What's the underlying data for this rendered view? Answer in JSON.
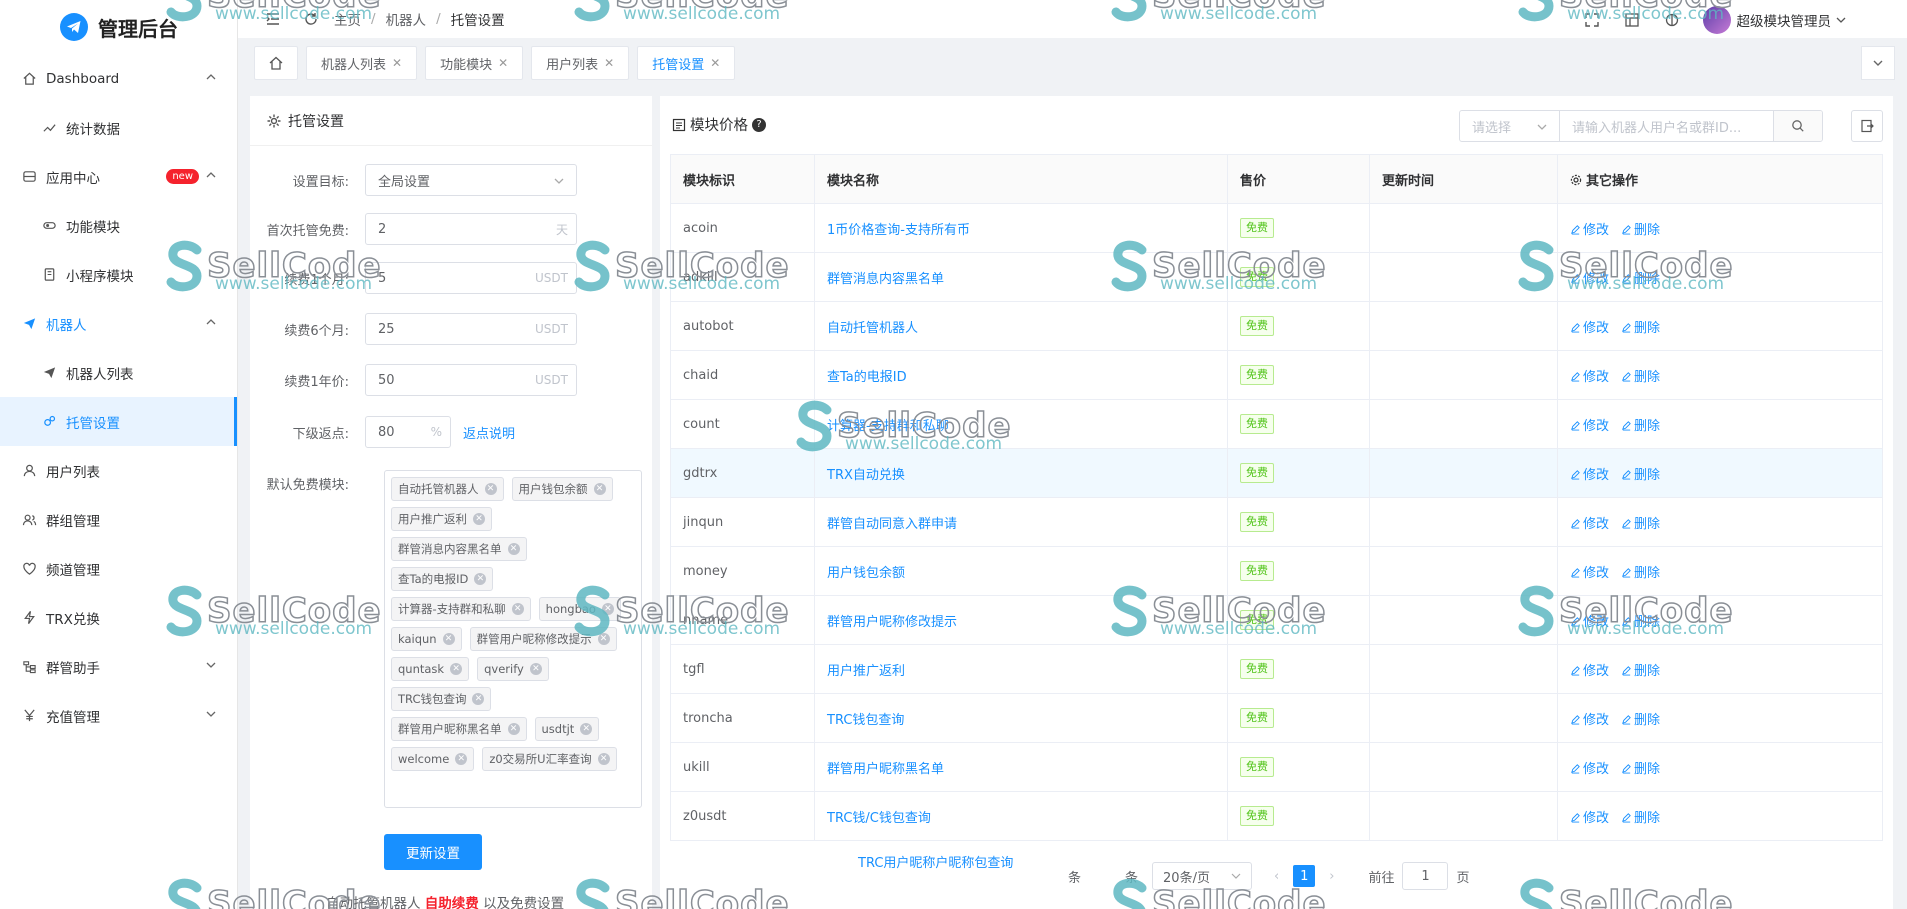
{
  "app": {
    "logo_title": "管理后台"
  },
  "sidebar": {
    "items": [
      {
        "label": "Dashboard",
        "icon": "home-icon",
        "level": 0,
        "expanded": true
      },
      {
        "label": "统计数据",
        "icon": "chart-trend-icon",
        "level": 1
      },
      {
        "label": "应用中心",
        "icon": "app-icon",
        "level": 0,
        "badge": "new",
        "expanded": true
      },
      {
        "label": "功能模块",
        "icon": "toggle-icon",
        "level": 1
      },
      {
        "label": "小程序模块",
        "icon": "mini-program-icon",
        "level": 1
      },
      {
        "label": "机器人",
        "icon": "send-icon",
        "level": 0,
        "expanded": true,
        "active": true
      },
      {
        "label": "机器人列表",
        "icon": "send-icon",
        "level": 1
      },
      {
        "label": "托管设置",
        "icon": "gears-icon",
        "level": 1,
        "selected": true
      },
      {
        "label": "用户列表",
        "icon": "user-icon",
        "level": 0
      },
      {
        "label": "群组管理",
        "icon": "group-icon",
        "level": 0
      },
      {
        "label": "频道管理",
        "icon": "heart-icon",
        "level": 0
      },
      {
        "label": "TRX兑换",
        "icon": "bolt-icon",
        "level": 0
      },
      {
        "label": "群管助手",
        "icon": "tree-icon",
        "level": 0,
        "collapsed": true
      },
      {
        "label": "充值管理",
        "icon": "yen-icon",
        "level": 0,
        "collapsed": true
      }
    ]
  },
  "header": {
    "breadcrumb": [
      "主页",
      "机器人",
      "托管设置"
    ],
    "username": "超级模块管理员"
  },
  "tabs": [
    {
      "label": "机器人列表"
    },
    {
      "label": "功能模块"
    },
    {
      "label": "用户列表"
    },
    {
      "label": "托管设置",
      "active": true
    }
  ],
  "settings": {
    "title": "托管设置",
    "target_label": "设置目标:",
    "target_value": "全局设置",
    "first_free_label": "首次托管免费:",
    "first_free_value": "2",
    "first_free_unit": "天",
    "renew1m_label": "续费1个月:",
    "renew1m_value": "5",
    "renew6m_label": "续费6个月:",
    "renew6m_value": "25",
    "renew1y_label": "续费1年价:",
    "renew1y_value": "50",
    "currency": "USDT",
    "rebate_label": "下级返点:",
    "rebate_value": "80",
    "rebate_unit": "%",
    "rebate_link": "返点说明",
    "free_modules_label": "默认免费模块:",
    "free_modules": [
      "自动托管机器人",
      "用户钱包余额",
      "用户推广返利",
      "群管消息内容黑名单",
      "查Ta的电报ID",
      "计算器-支持群和私聊",
      "hongbao",
      "kaiqun",
      "群管用户昵称修改提示",
      "quntask",
      "qverify",
      "TRC钱包查询",
      "群管用户昵称黑名单",
      "usdtjt",
      "welcome",
      "z0交易所U汇率查询"
    ],
    "update_button": "更新设置",
    "foot_prefix": "自动托管机器人",
    "foot_emph": "自助续费",
    "foot_suffix": "以及免费设置"
  },
  "module_price": {
    "title": "模块价格",
    "help": "?",
    "select_placeholder": "请选择",
    "search_placeholder": "请输入机器人用户名或群ID...",
    "columns": [
      "模块标识",
      "模块名称",
      "售价",
      "更新时间",
      "其它操作"
    ],
    "edit_label": "修改",
    "delete_label": "删除",
    "rows": [
      {
        "id": "acoin",
        "name": "1币价格查询-支持所有币",
        "price": "免费",
        "time": ""
      },
      {
        "id": "adkill",
        "name": "群管消息内容黑名单",
        "price": "免费",
        "time": ""
      },
      {
        "id": "autobot",
        "name": "自动托管机器人",
        "price": "免费",
        "time": ""
      },
      {
        "id": "chaid",
        "name": "查Ta的电报ID",
        "price": "免费",
        "time": ""
      },
      {
        "id": "count",
        "name": "计算器-支持群和私聊",
        "price": "免费",
        "time": ""
      },
      {
        "id": "gdtrx",
        "name": "TRX自动兑换",
        "price": "免费",
        "time": "",
        "highlight": true
      },
      {
        "id": "jinqun",
        "name": "群管自动同意入群申请",
        "price": "免费",
        "time": ""
      },
      {
        "id": "money",
        "name": "用户钱包余额",
        "price": "免费",
        "time": ""
      },
      {
        "id": "nname",
        "name": "群管用户昵称修改提示",
        "price": "免费",
        "time": ""
      },
      {
        "id": "tgfl",
        "name": "用户推广返利",
        "price": "免费",
        "time": ""
      },
      {
        "id": "troncha",
        "name": "TRC钱包查询",
        "price": "免费",
        "time": ""
      },
      {
        "id": "ukill",
        "name": "群管用户昵称黑名单",
        "price": "免费",
        "time": ""
      },
      {
        "id": "z0usdt",
        "name": "TRC钱/C钱包查询",
        "price": "免费",
        "time": ""
      }
    ],
    "below_link": "TRC用户昵称户昵称包查询",
    "pager": {
      "total_label": "条",
      "total_label2": "条",
      "page_size": "20条/页",
      "current": "1",
      "goto_label": "前往",
      "goto_value": "1",
      "page_label": "页"
    }
  },
  "watermark": {
    "brand": "SellCode",
    "url": "www.sellcode.com"
  }
}
